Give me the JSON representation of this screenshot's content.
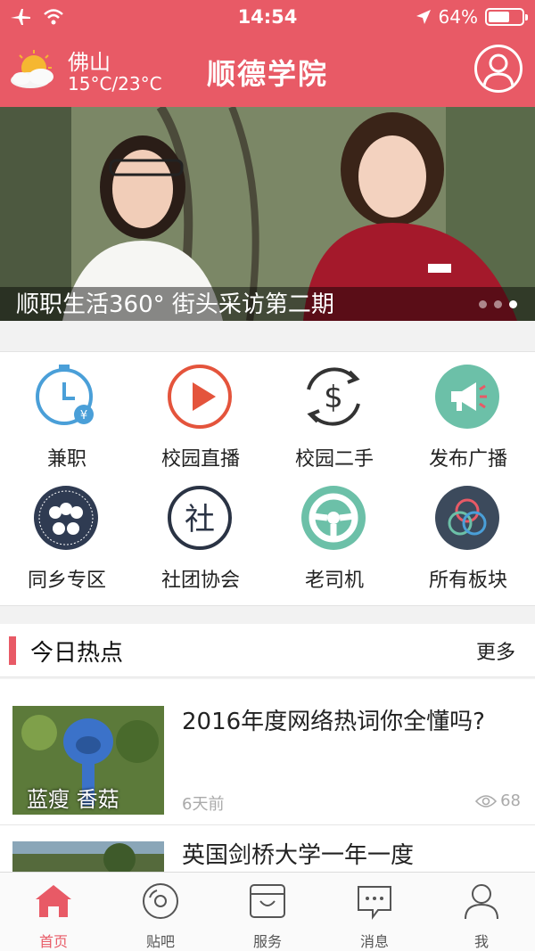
{
  "status_bar": {
    "time": "14:54",
    "battery_text": "64%",
    "battery_level": 0.64
  },
  "header": {
    "city": "佛山",
    "temperature": "15°C/23°C",
    "title": "顺德学院",
    "accent_color": "#e85a66"
  },
  "banner": {
    "caption": "顺职生活360° 街头采访第二期",
    "slide_count": 3,
    "active_slide": 3
  },
  "grid": {
    "items": [
      {
        "label": "兼职",
        "icon": "clock-money-icon"
      },
      {
        "label": "校园直播",
        "icon": "play-icon"
      },
      {
        "label": "校园二手",
        "icon": "dollar-cycle-icon"
      },
      {
        "label": "发布广播",
        "icon": "megaphone-icon"
      },
      {
        "label": "同乡专区",
        "icon": "people-group-icon"
      },
      {
        "label": "社团协会",
        "icon": "club-icon"
      },
      {
        "label": "老司机",
        "icon": "steering-wheel-icon"
      },
      {
        "label": "所有板块",
        "icon": "all-boards-icon"
      }
    ]
  },
  "hot_section": {
    "title": "今日热点",
    "more_label": "更多"
  },
  "feed": {
    "items": [
      {
        "title": "2016年度网络热词你全懂吗?",
        "thumb_caption": "蓝瘦 香菇",
        "time": "6天前",
        "views": "68"
      },
      {
        "title": "英国剑桥大学一年一度",
        "thumb_caption": "",
        "time": "",
        "views": ""
      }
    ]
  },
  "tabbar": {
    "tabs": [
      {
        "label": "首页",
        "icon": "home-icon",
        "active": true
      },
      {
        "label": "贴吧",
        "icon": "disc-icon",
        "active": false
      },
      {
        "label": "服务",
        "icon": "basket-icon",
        "active": false
      },
      {
        "label": "消息",
        "icon": "chat-bubble-icon",
        "active": false
      },
      {
        "label": "我",
        "icon": "user-icon",
        "active": false
      }
    ]
  }
}
